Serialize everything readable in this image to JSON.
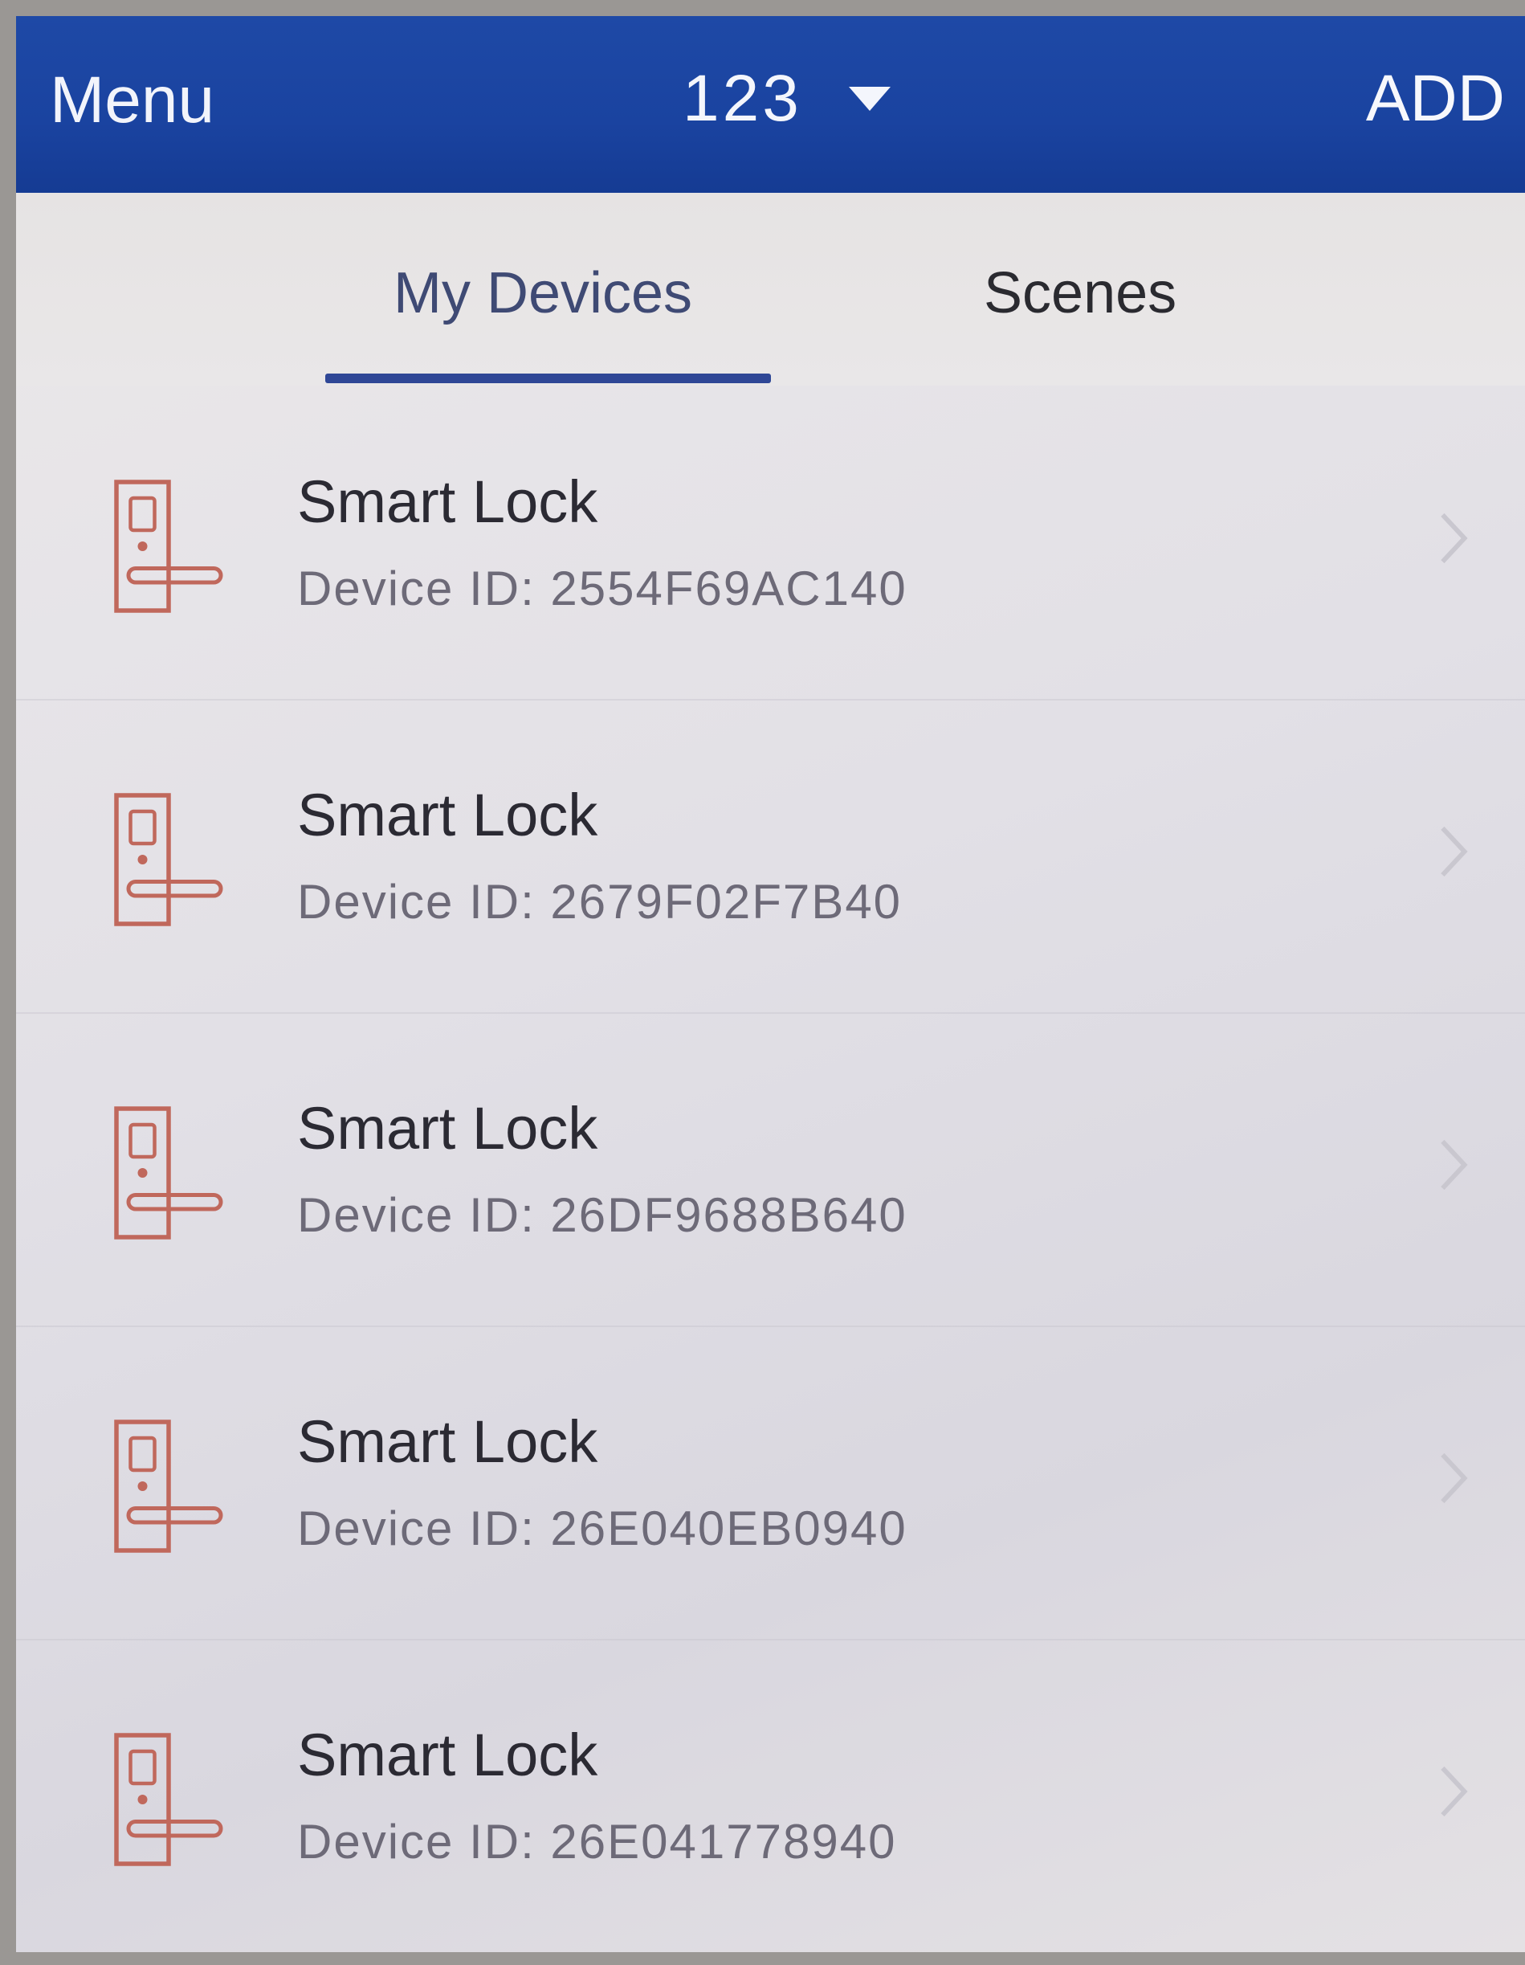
{
  "header": {
    "menu_label": "Menu",
    "site_name": "123",
    "add_label": "ADD"
  },
  "tabs": [
    {
      "label": "My Devices",
      "active": true
    },
    {
      "label": "Scenes",
      "active": false
    }
  ],
  "devices": [
    {
      "name": "Smart Lock",
      "id_text": "Device ID: 2554F69AC140",
      "icon": "door-lock-icon"
    },
    {
      "name": "Smart Lock",
      "id_text": "Device ID: 2679F02F7B40",
      "icon": "door-lock-icon"
    },
    {
      "name": "Smart Lock",
      "id_text": "Device ID: 26DF9688B640",
      "icon": "door-lock-icon"
    },
    {
      "name": "Smart Lock",
      "id_text": "Device ID: 26E040EB0940",
      "icon": "door-lock-icon"
    },
    {
      "name": "Smart Lock",
      "id_text": "Device ID: 26E041778940",
      "icon": "door-lock-icon"
    }
  ],
  "colors": {
    "header_bg": "#1a43a0",
    "tab_indicator": "#2f4796",
    "lock_icon": "#c0685c"
  }
}
